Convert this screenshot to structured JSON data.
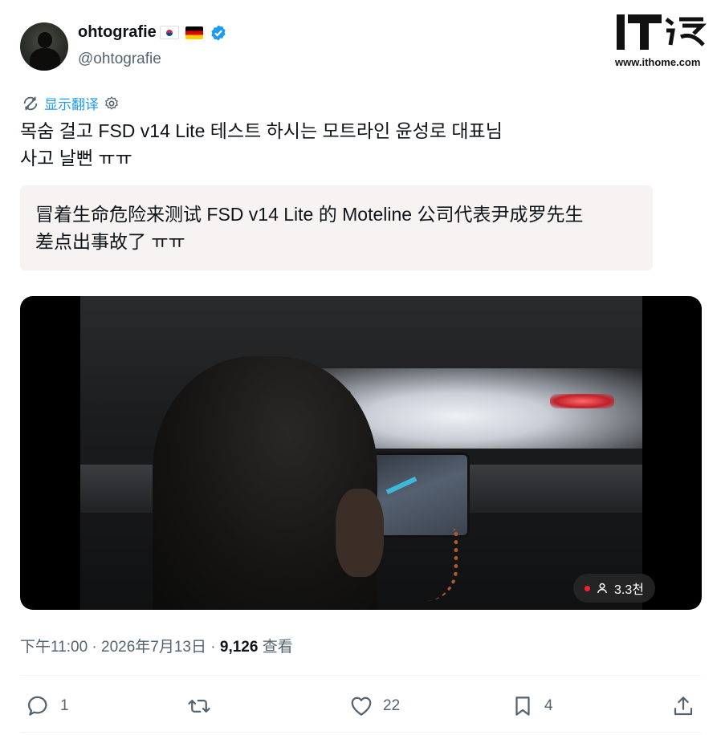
{
  "author": {
    "display_name": "ohtografie",
    "handle": "@ohtografie"
  },
  "watermark": {
    "logo_text": "IT之家",
    "url": "www.ithome.com"
  },
  "translate": {
    "label": "显示翻译"
  },
  "tweet": {
    "lines": [
      "목숨 걸고 FSD v14 Lite 테스트 하시는 모트라인 윤성로 대표님",
      "사고 날뻔 ㅠㅠ"
    ]
  },
  "translation": {
    "lines": [
      "冒着生命危险来测试 FSD v14 Lite 的 Moteline 公司代表尹成罗先生",
      "差点出事故了 ㅠㅠ"
    ]
  },
  "video": {
    "viewers_label": "3.3천"
  },
  "meta": {
    "time": "下午11:00",
    "separator": "·",
    "date": "2026年7月13日",
    "views_count": "9,126",
    "views_label": "查看"
  },
  "actions": {
    "replies": "1",
    "retweets": "",
    "likes": "22",
    "bookmarks": "4"
  },
  "colors": {
    "accent": "#1d9bf0",
    "text": "#0f1419",
    "secondary": "#536471",
    "live": "#f4212e"
  }
}
